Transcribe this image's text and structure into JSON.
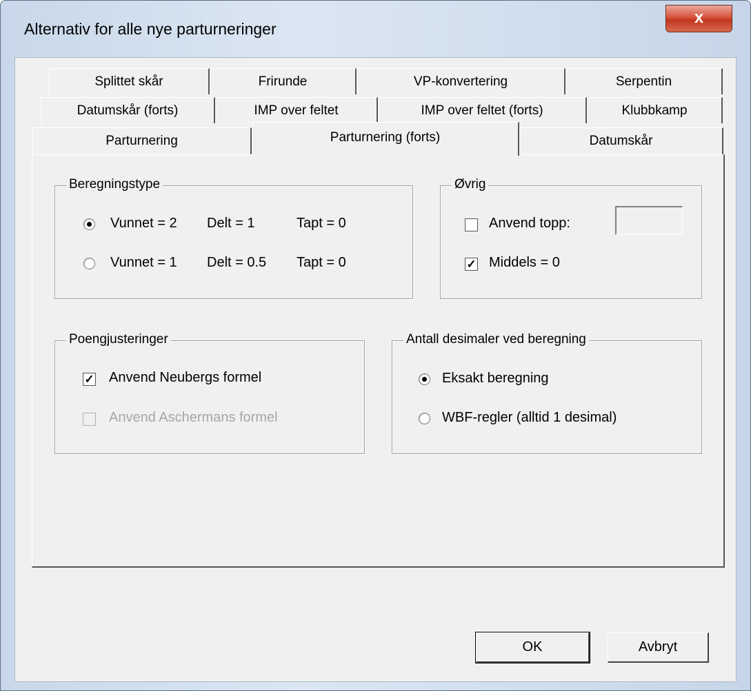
{
  "window": {
    "title": "Alternativ for alle nye parturneringer",
    "close_label": "x"
  },
  "tabs": {
    "row1": [
      "Splittet skår",
      "Frirunde",
      "VP-konvertering",
      "Serpentin"
    ],
    "row2": [
      "Datumskår (forts)",
      "IMP over feltet",
      "IMP over feltet (forts)",
      "Klubbkamp"
    ],
    "row3": [
      "Parturnering",
      "Parturnering (forts)",
      "Datumskår"
    ],
    "active": "Parturnering (forts)"
  },
  "beregningstype": {
    "legend": "Beregningstype",
    "options": [
      {
        "vunnet": "Vunnet = 2",
        "delt": "Delt = 1",
        "tapt": "Tapt = 0",
        "selected": true
      },
      {
        "vunnet": "Vunnet = 1",
        "delt": "Delt = 0.5",
        "tapt": "Tapt = 0",
        "selected": false
      }
    ]
  },
  "ovrig": {
    "legend": "Øvrig",
    "anvend_topp": {
      "label": "Anvend topp:",
      "checked": false,
      "value": ""
    },
    "middels": {
      "label": "Middels = 0",
      "checked": true
    }
  },
  "poengjusteringer": {
    "legend": "Poengjusteringer",
    "neuberg": {
      "label": "Anvend Neubergs formel",
      "checked": true
    },
    "aschermann": {
      "label": "Anvend Aschermans formel",
      "checked": false,
      "disabled": true
    }
  },
  "desimaler": {
    "legend": "Antall desimaler ved beregning",
    "options": [
      {
        "label": "Eksakt beregning",
        "selected": true
      },
      {
        "label": "WBF-regler (alltid 1 desimal)",
        "selected": false
      }
    ]
  },
  "buttons": {
    "ok": "OK",
    "cancel": "Avbryt"
  }
}
